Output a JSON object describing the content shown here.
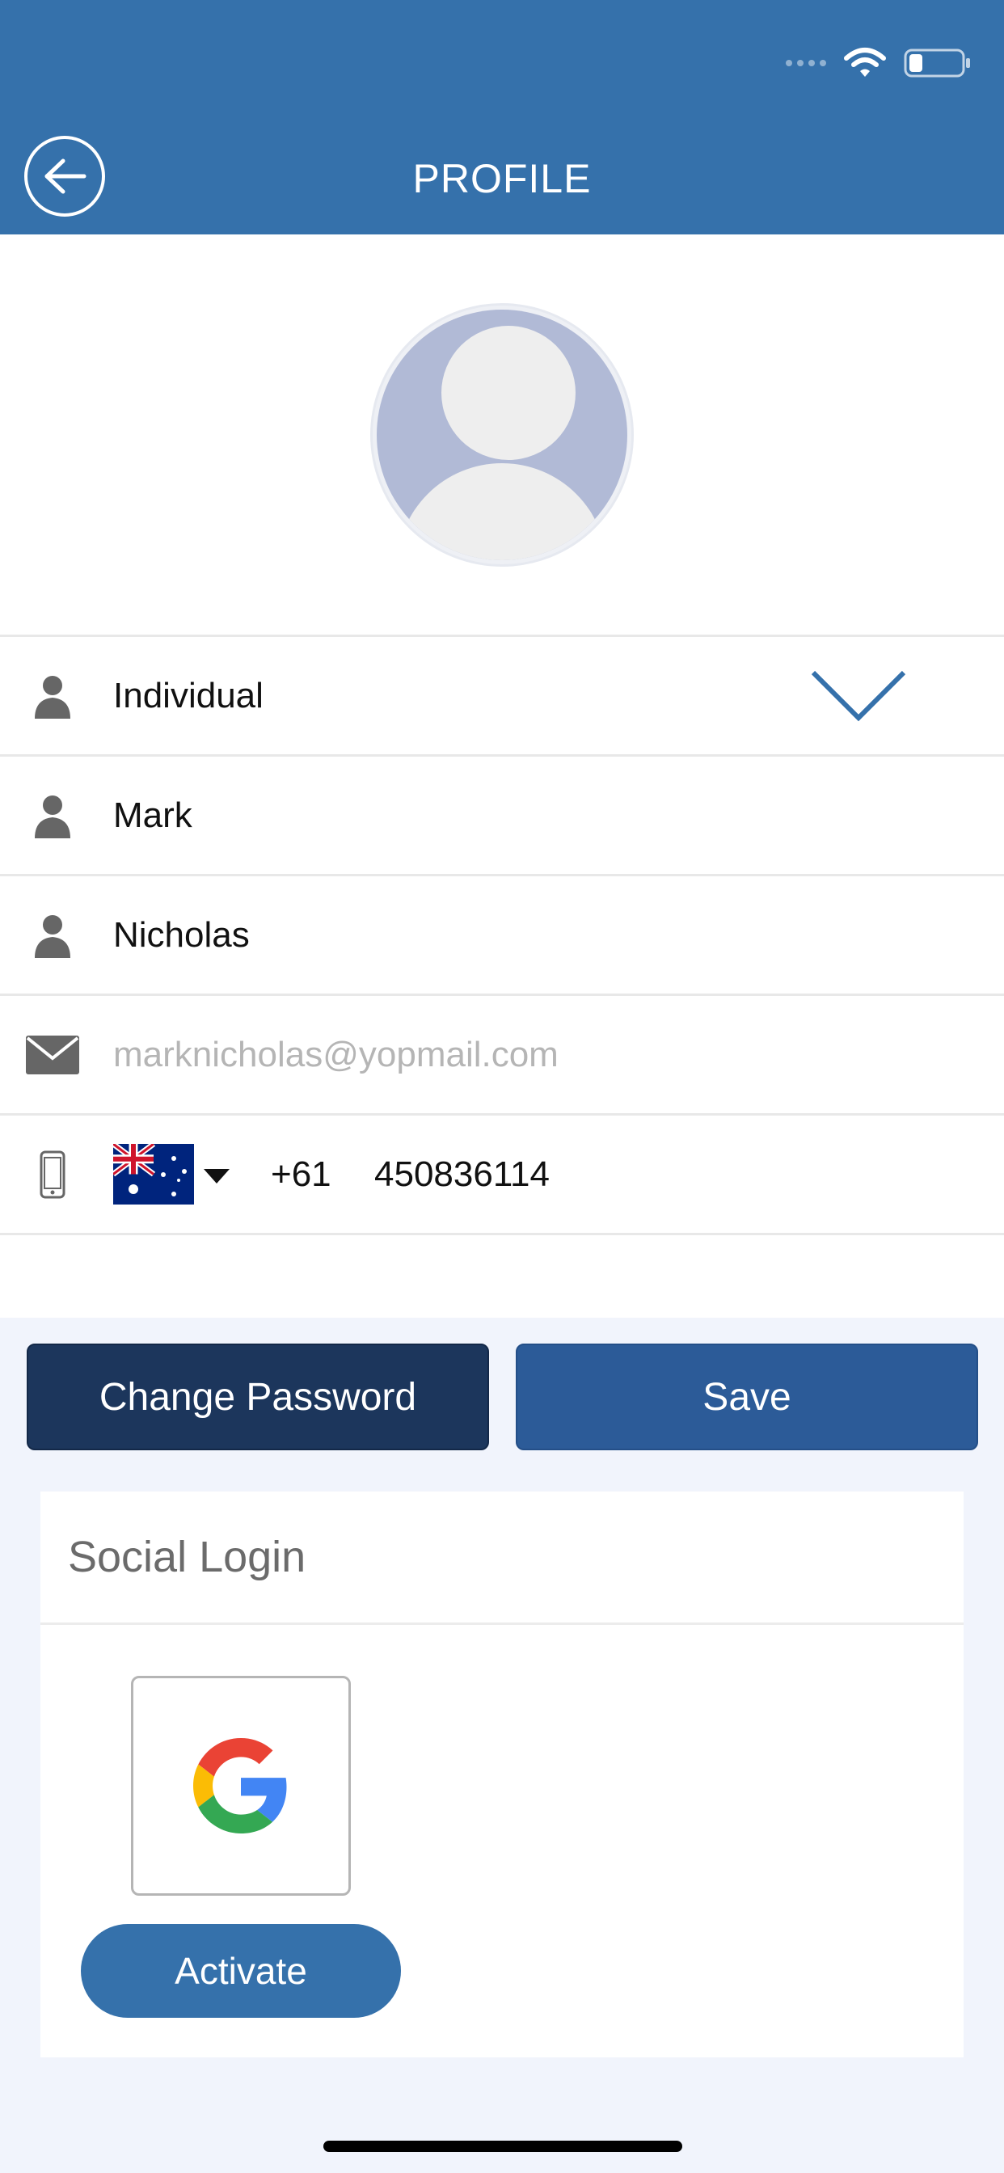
{
  "header": {
    "title": "PROFILE",
    "background": "#3571ab"
  },
  "status_bar": {
    "icons": [
      "cellular-signal-icon",
      "wifi-icon",
      "battery-icon"
    ]
  },
  "avatar": {
    "icon": "default-user-avatar"
  },
  "fields": {
    "account_type": "Individual",
    "first_name": "Mark",
    "last_name": "Nicholas",
    "email_placeholder": "marknicholas@yopmail.com",
    "country_flag": "australia-flag",
    "dial_code": "+61",
    "phone": "450836114"
  },
  "buttons": {
    "change_password": "Change Password",
    "save": "Save"
  },
  "social": {
    "title": "Social Login",
    "provider_icon": "google-icon",
    "activate_label": "Activate"
  },
  "colors": {
    "primary": "#3571ab",
    "dark_button": "#1c365c",
    "save_button": "#2c5b98",
    "lower_bg": "#f1f4fc"
  }
}
